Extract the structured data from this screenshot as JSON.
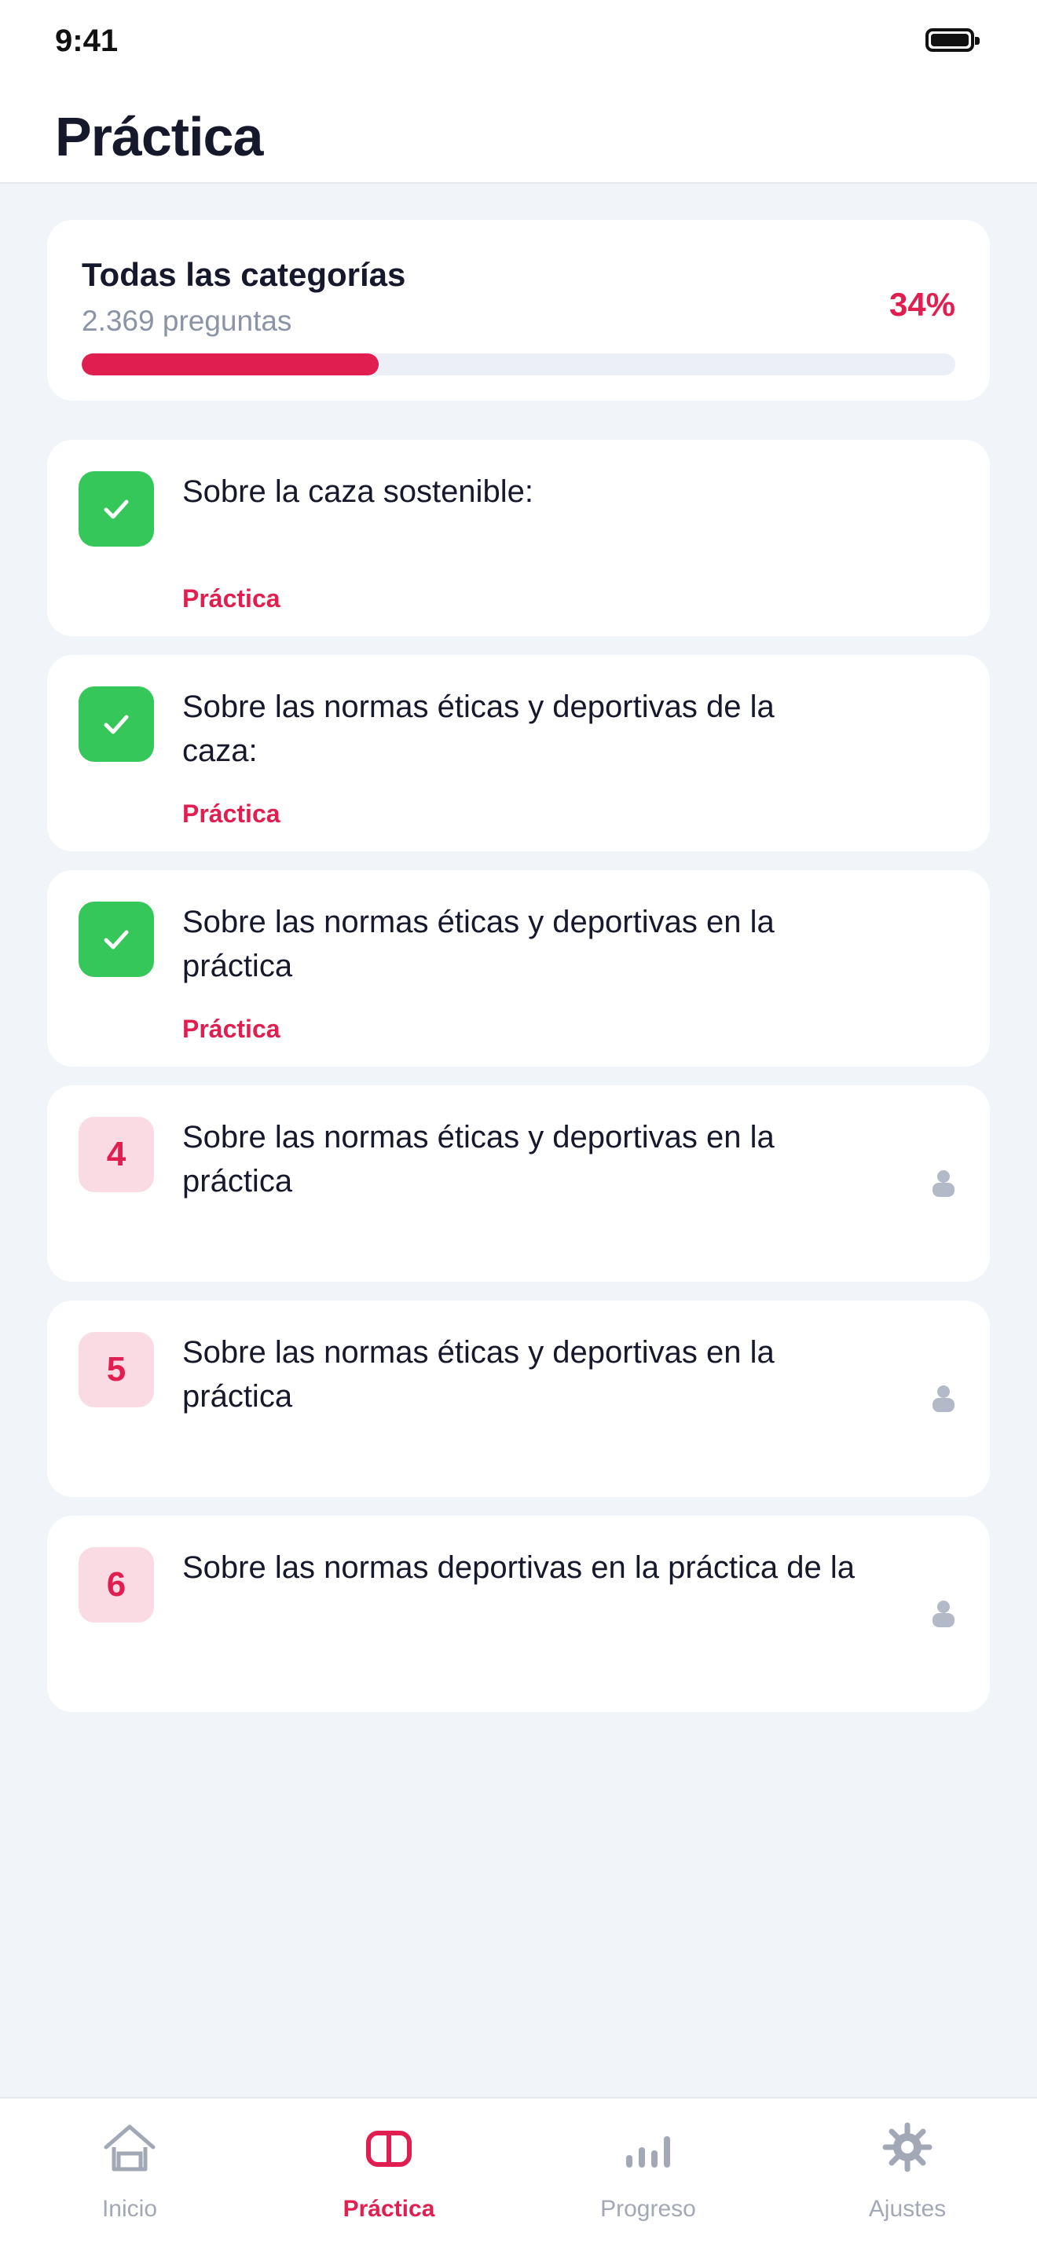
{
  "status_bar": {
    "time": "9:41"
  },
  "header": {
    "title": "Práctica"
  },
  "summary": {
    "title": "Todas las categorías",
    "subtitle": "2.369 preguntas",
    "percent_label": "34%",
    "progress": 0.34
  },
  "items": [
    {
      "badge": "",
      "state": "completed",
      "title": "Sobre la caza sostenible:",
      "tag": "Práctica"
    },
    {
      "badge": "",
      "state": "completed",
      "title": "Sobre las normas éticas y deportivas de la caza:",
      "tag": "Práctica"
    },
    {
      "badge": "",
      "state": "completed",
      "title": "Sobre las normas éticas y deportivas en la práctica",
      "tag": "Práctica"
    },
    {
      "badge": "4",
      "state": "locked",
      "title": "Sobre las normas éticas y deportivas en la práctica",
      "tag": ""
    },
    {
      "badge": "5",
      "state": "locked",
      "title": "Sobre las normas éticas y deportivas en la práctica",
      "tag": ""
    },
    {
      "badge": "6",
      "state": "locked",
      "title": "Sobre las normas deportivas en la práctica de la",
      "tag": ""
    }
  ],
  "tabbar": {
    "tabs": [
      {
        "label": "Inicio",
        "icon": "home-icon",
        "active": false
      },
      {
        "label": "Práctica",
        "icon": "book-icon",
        "active": true
      },
      {
        "label": "Progreso",
        "icon": "bar-chart-icon",
        "active": false
      },
      {
        "label": "Ajustes",
        "icon": "gear-icon",
        "active": false
      }
    ]
  },
  "colors": {
    "accent": "#e01e4f",
    "success": "#35c759",
    "background": "#f1f4f9",
    "muted": "#a2a8b6"
  }
}
